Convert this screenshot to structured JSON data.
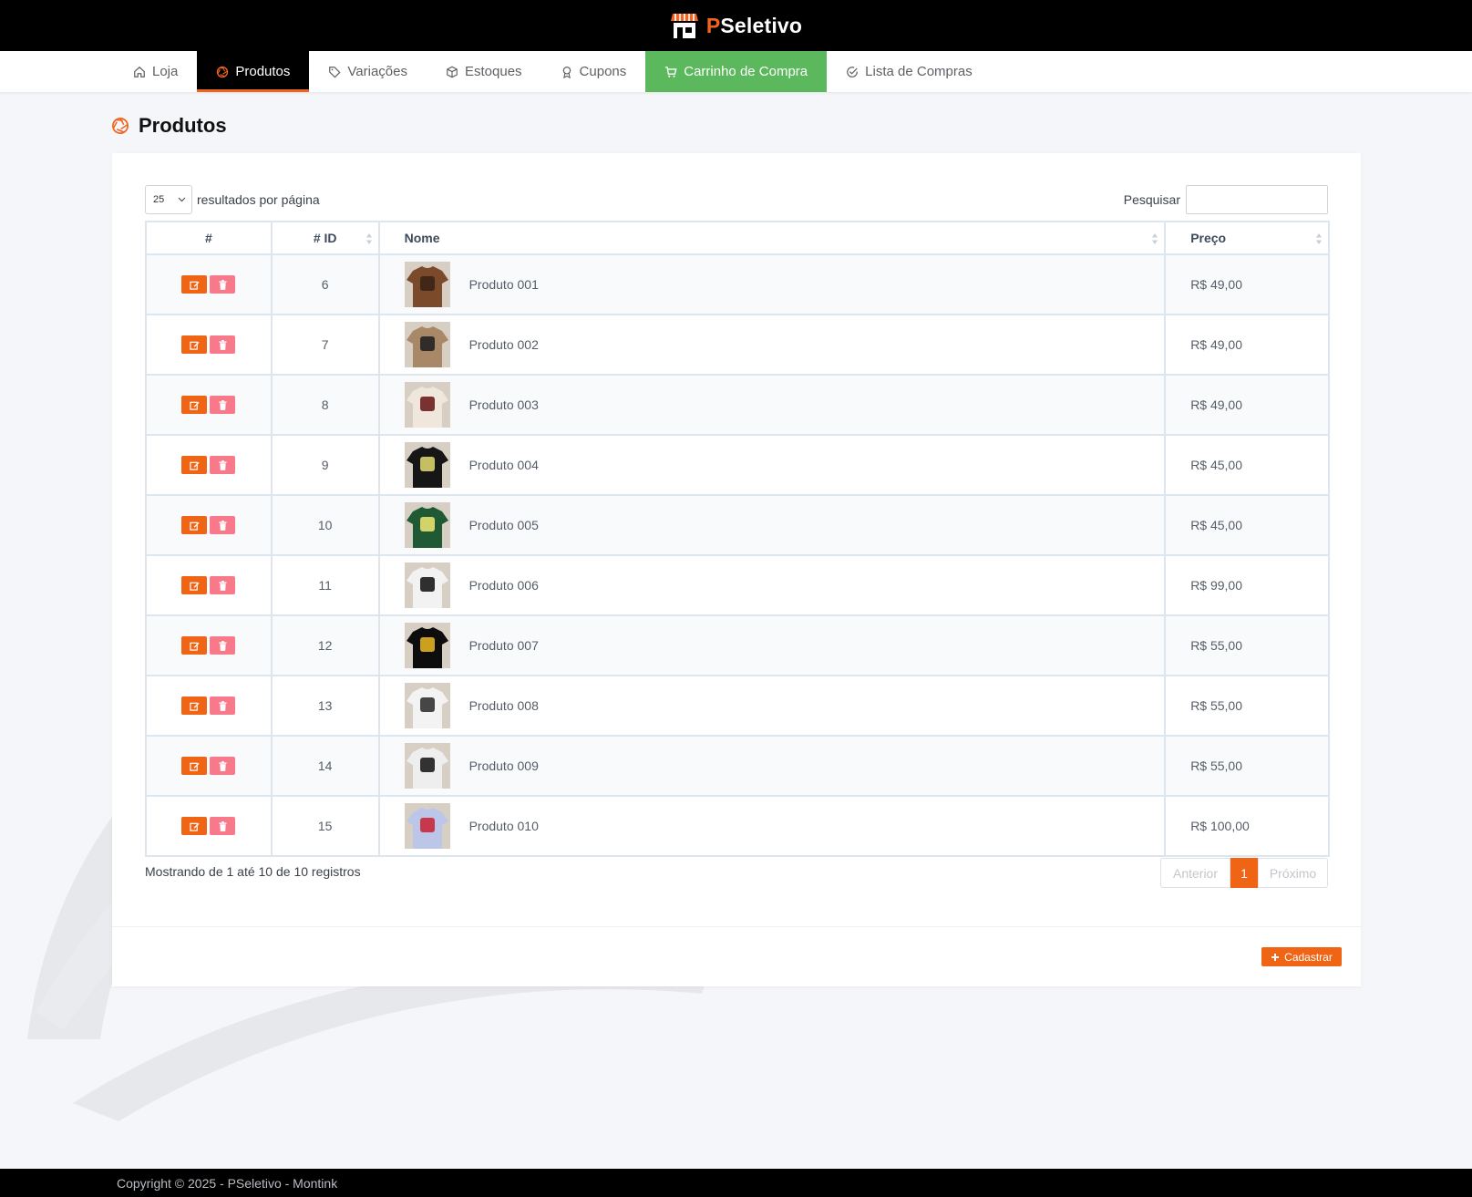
{
  "brand": {
    "prefix": "P",
    "rest": "Seletivo"
  },
  "nav": [
    {
      "label": "Loja",
      "icon": "home-icon"
    },
    {
      "label": "Produtos",
      "icon": "aperture-icon",
      "active": true
    },
    {
      "label": "Variações",
      "icon": "tag-icon"
    },
    {
      "label": "Estoques",
      "icon": "box-icon"
    },
    {
      "label": "Cupons",
      "icon": "award-icon"
    },
    {
      "label": "Carrinho de Compra",
      "icon": "cart-icon"
    },
    {
      "label": "Lista de Compras",
      "icon": "check-circle-icon"
    }
  ],
  "page": {
    "title": "Produtos"
  },
  "table_controls": {
    "page_length": "25",
    "page_length_suffix": "resultados por página",
    "search_label": "Pesquisar",
    "search_value": ""
  },
  "columns": {
    "actions": "#",
    "id": "# ID",
    "name": "Nome",
    "price": "Preço"
  },
  "rows": [
    {
      "id": "6",
      "name": "Produto 001",
      "price": "R$ 49,00",
      "shirt": "#7a4a2a",
      "print": "#3a2416"
    },
    {
      "id": "7",
      "name": "Produto 002",
      "price": "R$ 49,00",
      "shirt": "#a88866",
      "print": "#222222"
    },
    {
      "id": "8",
      "name": "Produto 003",
      "price": "R$ 49,00",
      "shirt": "#efe6dc",
      "print": "#6b1e1e"
    },
    {
      "id": "9",
      "name": "Produto 004",
      "price": "R$ 45,00",
      "shirt": "#161616",
      "print": "#d8d06a"
    },
    {
      "id": "10",
      "name": "Produto 005",
      "price": "R$ 45,00",
      "shirt": "#1f5a34",
      "print": "#e8e070"
    },
    {
      "id": "11",
      "name": "Produto 006",
      "price": "R$ 99,00",
      "shirt": "#f2f2f2",
      "print": "#1a1a1a"
    },
    {
      "id": "12",
      "name": "Produto 007",
      "price": "R$ 55,00",
      "shirt": "#0d0d0d",
      "print": "#e0b020"
    },
    {
      "id": "13",
      "name": "Produto 008",
      "price": "R$ 55,00",
      "shirt": "#f3f3f3",
      "print": "#333333"
    },
    {
      "id": "14",
      "name": "Produto 009",
      "price": "R$ 55,00",
      "shirt": "#eeeeee",
      "print": "#1d1d1d"
    },
    {
      "id": "15",
      "name": "Produto 010",
      "price": "R$ 100,00",
      "shirt": "#bcc6e8",
      "print": "#c8283a"
    }
  ],
  "info": "Mostrando de 1 até 10 de 10 registros",
  "pagination": {
    "prev": "Anterior",
    "current": "1",
    "next": "Próximo"
  },
  "actions": {
    "register": "Cadastrar"
  },
  "footer": {
    "copyright": "Copyright © 2025 - PSeletivo - Montink"
  },
  "colors": {
    "accent": "#ef6415",
    "cart": "#5cb85c",
    "danger": "#f7798a"
  }
}
